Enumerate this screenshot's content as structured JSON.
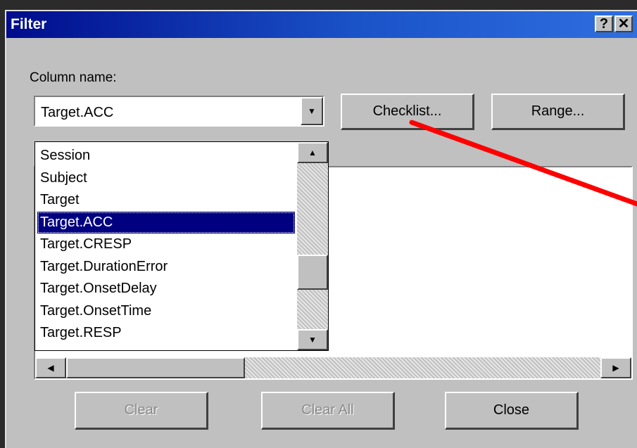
{
  "window": {
    "title": "Filter",
    "help_label": "?",
    "close_label": "✕"
  },
  "column_label": "Column name:",
  "combo": {
    "value": "Target.ACC"
  },
  "buttons": {
    "checklist": "Checklist...",
    "range": "Range..."
  },
  "dropdown": {
    "items": [
      "Session",
      "Subject",
      "Target",
      "Target.ACC",
      "Target.CRESP",
      "Target.DurationError",
      "Target.OnsetDelay",
      "Target.OnsetTime",
      "Target.RESP"
    ],
    "selected_index": 3
  },
  "footer": {
    "clear": "Clear",
    "clear_all": "Clear All",
    "close": "Close"
  },
  "annotation": {
    "color": "#ff0000"
  }
}
